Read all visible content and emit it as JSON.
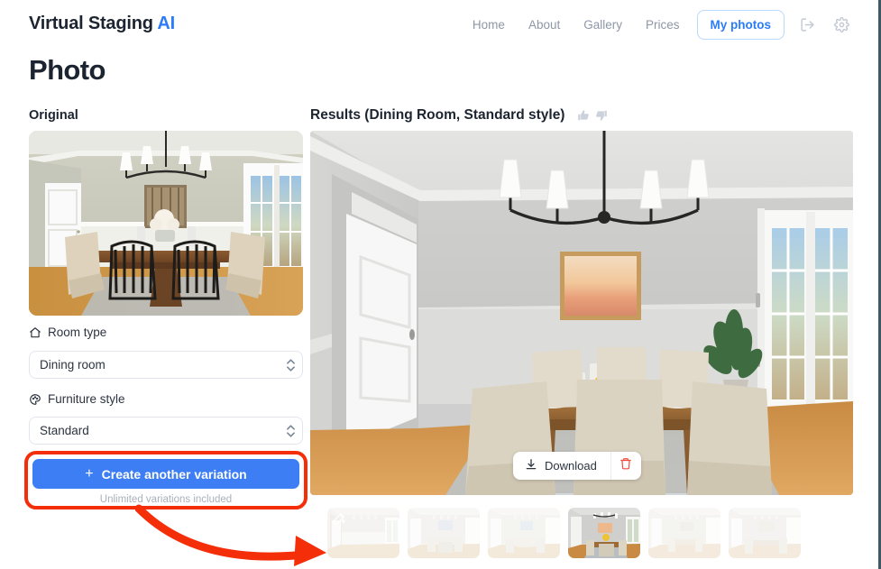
{
  "brand": {
    "name": "Virtual Staging",
    "accent_word": "AI",
    "accent_color": "#2b7cf6"
  },
  "nav": {
    "links": [
      {
        "label": "Home"
      },
      {
        "label": "About"
      },
      {
        "label": "Gallery"
      },
      {
        "label": "Prices"
      }
    ],
    "active_button": "My photos",
    "icons": [
      {
        "name": "logout-icon"
      },
      {
        "name": "gear-icon"
      }
    ]
  },
  "page": {
    "title": "Photo"
  },
  "original": {
    "label": "Original",
    "image_alt": "Original dining room photo with wooden table, black metal chairs, chandelier and french doors"
  },
  "controls": {
    "room_type": {
      "label": "Room type",
      "icon": "home-icon",
      "value": "Dining room"
    },
    "furniture_style": {
      "label": "Furniture style",
      "icon": "palette-icon",
      "value": "Standard"
    },
    "cta": {
      "label": "Create another variation",
      "icon": "plus-icon",
      "subtitle": "Unlimited variations included",
      "color": "#3d7ef4"
    }
  },
  "annotation": {
    "color": "#f42e09",
    "highlight_target": "create-another-variation-button",
    "arrow_target": "variation-thumbnails"
  },
  "results": {
    "heading": "Results (Dining Room, Standard style)",
    "rating_icons": [
      {
        "name": "thumbs-up-icon"
      },
      {
        "name": "thumbs-down-icon"
      }
    ],
    "image_alt": "Staged dining room with light wood table, cream upholstered chairs, chandelier, sunset artwork and yellow tulips",
    "download": {
      "label": "Download",
      "icon": "download-icon"
    },
    "delete": {
      "icon": "trash-icon",
      "color": "#f4483a"
    }
  },
  "thumbnails": [
    {
      "name": "thumb-empty-room",
      "selected": false,
      "badge": "magic-wand-icon"
    },
    {
      "name": "thumb-variation-1",
      "selected": false
    },
    {
      "name": "thumb-variation-2",
      "selected": false
    },
    {
      "name": "thumb-variation-3",
      "selected": true
    },
    {
      "name": "thumb-variation-4",
      "selected": false
    },
    {
      "name": "thumb-variation-5",
      "selected": false
    }
  ]
}
